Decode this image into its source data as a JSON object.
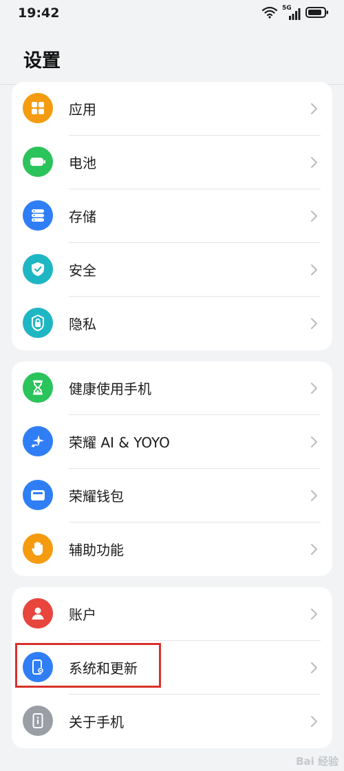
{
  "status_bar": {
    "time": "19:42",
    "network_label": "5G",
    "icons": [
      "wifi-icon",
      "cellular-signal-icon",
      "battery-icon"
    ]
  },
  "header": {
    "title": "设置"
  },
  "groups": [
    {
      "items": [
        {
          "label": "应用",
          "icon": "apps-grid-icon",
          "color": "#f59b0f"
        },
        {
          "label": "电池",
          "icon": "battery-icon",
          "color": "#2bc35b"
        },
        {
          "label": "存储",
          "icon": "storage-icon",
          "color": "#2f7ef5"
        },
        {
          "label": "安全",
          "icon": "shield-check-icon",
          "color": "#1fb6c4"
        },
        {
          "label": "隐私",
          "icon": "privacy-lock-icon",
          "color": "#1fb6c4"
        }
      ]
    },
    {
      "items": [
        {
          "label": "健康使用手机",
          "icon": "hourglass-icon",
          "color": "#2bc35b"
        },
        {
          "label": "荣耀 AI & YOYO",
          "icon": "ai-sparkle-icon",
          "color": "#2f7ef5"
        },
        {
          "label": "荣耀钱包",
          "icon": "wallet-icon",
          "color": "#2f7ef5"
        },
        {
          "label": "辅助功能",
          "icon": "hand-icon",
          "color": "#f59b0f"
        }
      ]
    },
    {
      "items": [
        {
          "label": "账户",
          "icon": "user-icon",
          "color": "#e8453c"
        },
        {
          "label": "系统和更新",
          "icon": "phone-settings-icon",
          "color": "#2f7ef5",
          "highlighted": true
        },
        {
          "label": "关于手机",
          "icon": "phone-info-icon",
          "color": "#9a9ea5"
        }
      ]
    }
  ],
  "highlight_color": "#d9302b",
  "watermark": "Bai 经验"
}
